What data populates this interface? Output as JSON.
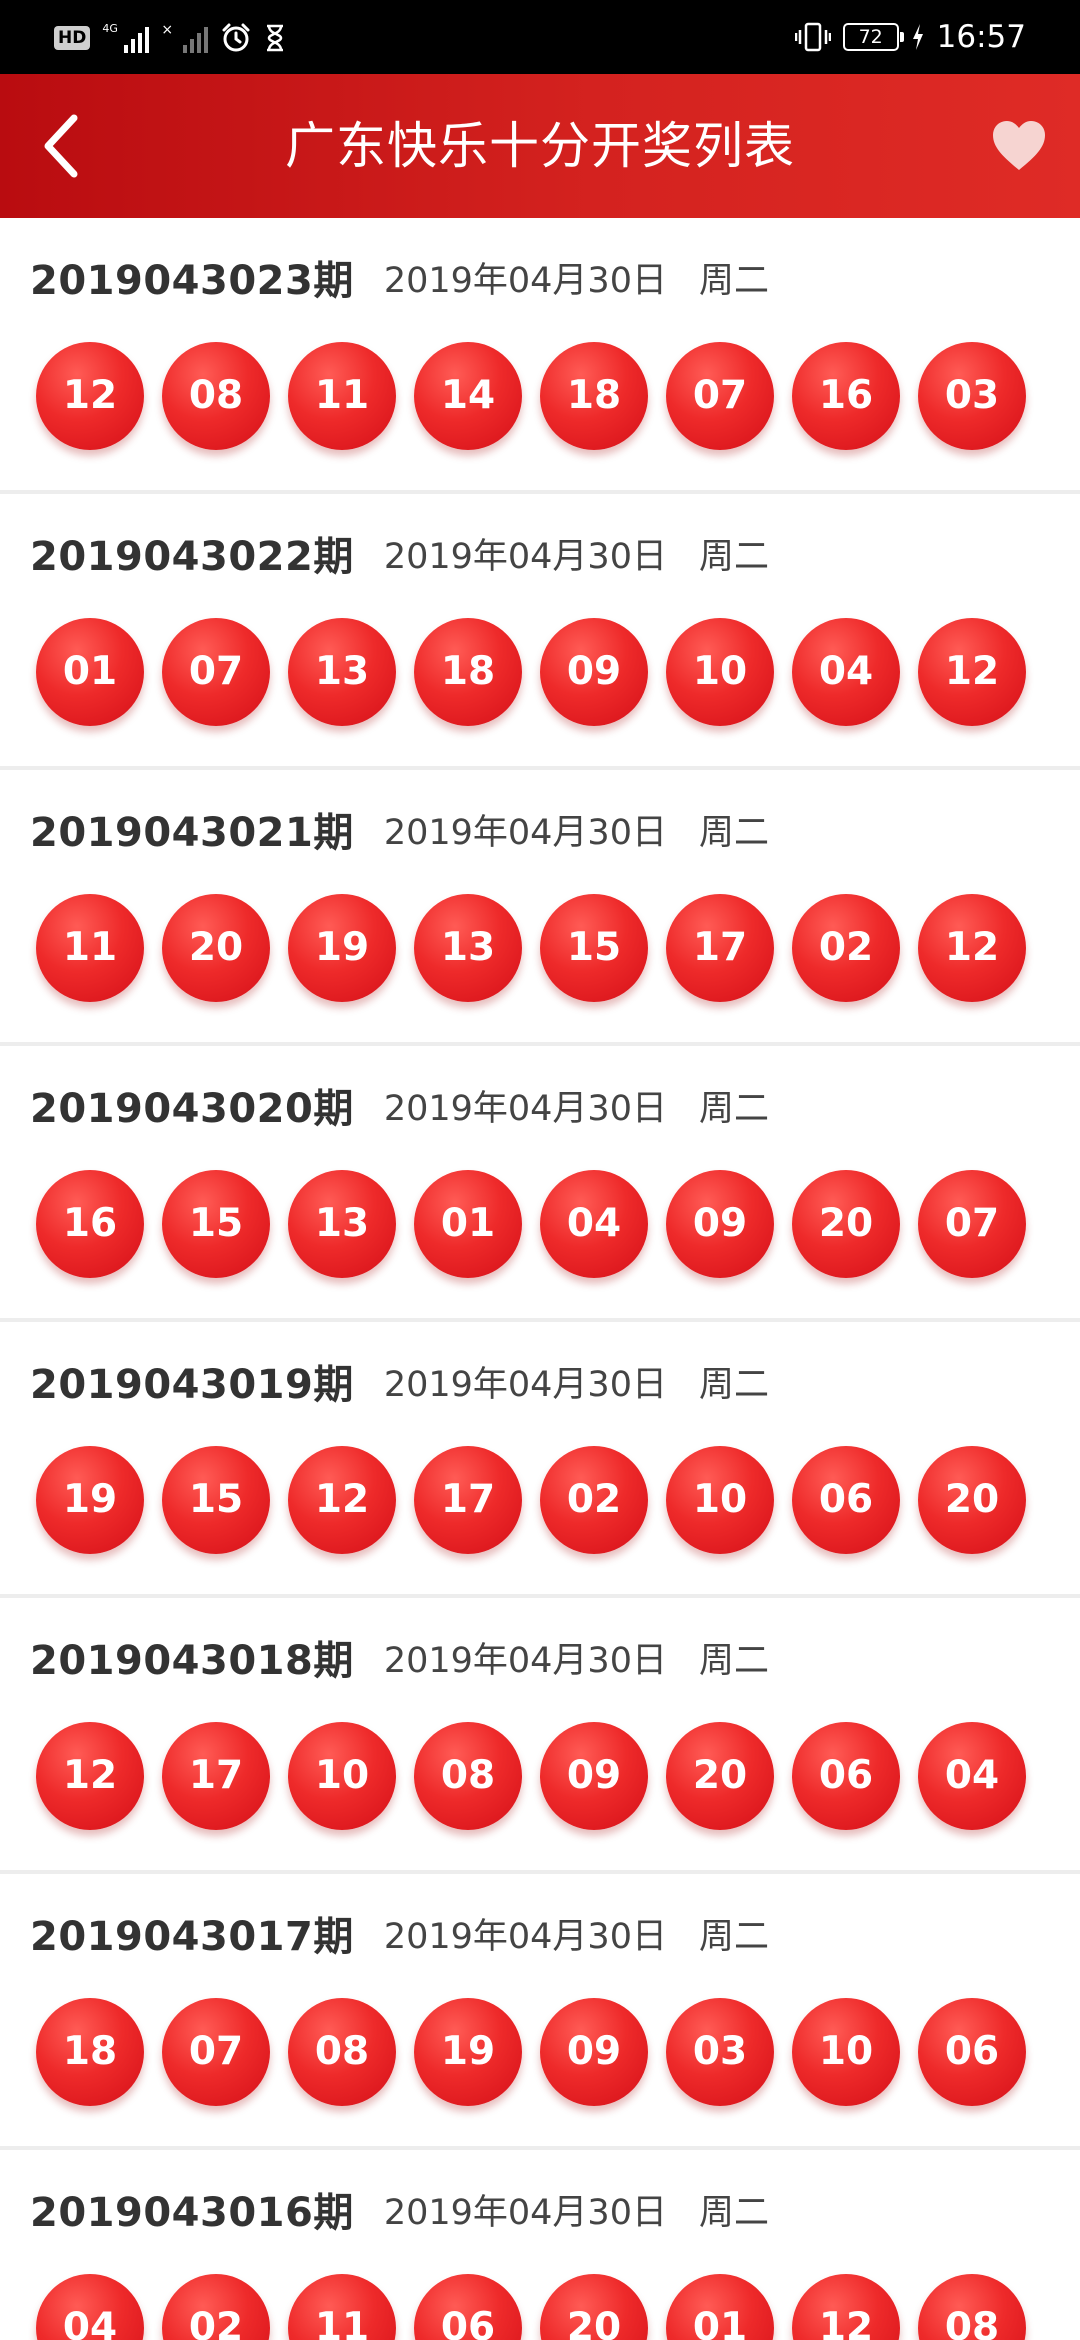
{
  "status_bar": {
    "hd_label": "HD",
    "network_label": "4G",
    "time": "16:57",
    "battery": "72",
    "icons": [
      "hd-icon",
      "signal-icon",
      "no-signal-icon",
      "alarm-icon",
      "hourglass-icon",
      "vibrate-icon",
      "battery-icon",
      "charging-icon"
    ]
  },
  "header": {
    "title": "广东快乐十分开奖列表",
    "back_icon": "chevron-left-icon",
    "favorite_icon": "heart-icon"
  },
  "colors": {
    "header_red": "#d4221f",
    "ball_red": "#ee2a2a"
  },
  "draws": [
    {
      "issue": "2019043023期",
      "date": "2019年04月30日",
      "weekday": "周二",
      "numbers": [
        "12",
        "08",
        "11",
        "14",
        "18",
        "07",
        "16",
        "03"
      ]
    },
    {
      "issue": "2019043022期",
      "date": "2019年04月30日",
      "weekday": "周二",
      "numbers": [
        "01",
        "07",
        "13",
        "18",
        "09",
        "10",
        "04",
        "12"
      ]
    },
    {
      "issue": "2019043021期",
      "date": "2019年04月30日",
      "weekday": "周二",
      "numbers": [
        "11",
        "20",
        "19",
        "13",
        "15",
        "17",
        "02",
        "12"
      ]
    },
    {
      "issue": "2019043020期",
      "date": "2019年04月30日",
      "weekday": "周二",
      "numbers": [
        "16",
        "15",
        "13",
        "01",
        "04",
        "09",
        "20",
        "07"
      ]
    },
    {
      "issue": "2019043019期",
      "date": "2019年04月30日",
      "weekday": "周二",
      "numbers": [
        "19",
        "15",
        "12",
        "17",
        "02",
        "10",
        "06",
        "20"
      ]
    },
    {
      "issue": "2019043018期",
      "date": "2019年04月30日",
      "weekday": "周二",
      "numbers": [
        "12",
        "17",
        "10",
        "08",
        "09",
        "20",
        "06",
        "04"
      ]
    },
    {
      "issue": "2019043017期",
      "date": "2019年04月30日",
      "weekday": "周二",
      "numbers": [
        "18",
        "07",
        "08",
        "19",
        "09",
        "03",
        "10",
        "06"
      ]
    },
    {
      "issue": "2019043016期",
      "date": "2019年04月30日",
      "weekday": "周二",
      "numbers": [
        "04",
        "02",
        "11",
        "06",
        "20",
        "01",
        "12",
        "08"
      ]
    }
  ]
}
